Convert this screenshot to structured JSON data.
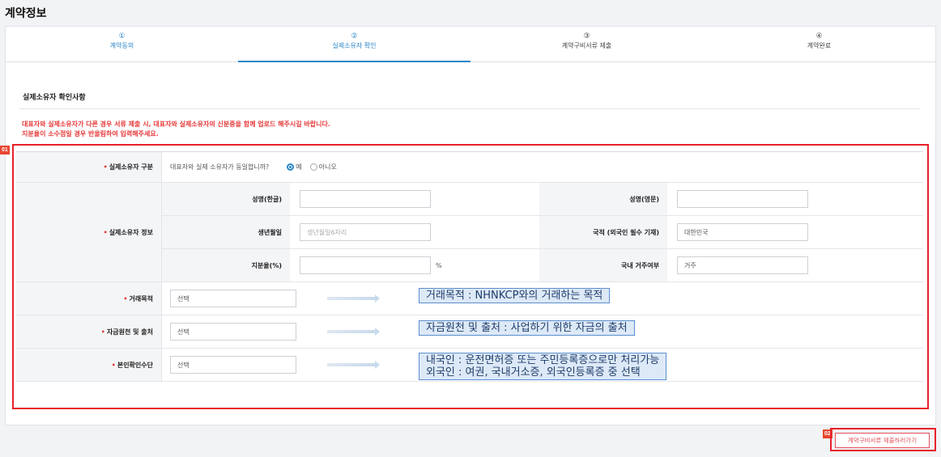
{
  "page_title": "계약정보",
  "steps": [
    {
      "num": "①",
      "label": "계약동의",
      "state": "done"
    },
    {
      "num": "②",
      "label": "실제소유자 확인",
      "state": "active"
    },
    {
      "num": "③",
      "label": "계약구비서류 제출",
      "state": "pending"
    },
    {
      "num": "④",
      "label": "계약완료",
      "state": "pending"
    }
  ],
  "section_title": "실제소유자 확인사항",
  "notice": {
    "line1": "대표자와 실제소유자가 다른 경우 서류 제출 시, 대표자와 실제소유자의 신분증을 함께 업로드 해주시길 바랍니다.",
    "line2": "지분율이 소수점일 경우 반올림하여 입력해주세요."
  },
  "markers": {
    "m1": "01",
    "m2": "02"
  },
  "owner_type": {
    "label": "실제소유자 구분",
    "question": "대표자와 실제 소유자가 동일합니까?",
    "options": [
      "예",
      "아니오"
    ],
    "selected": "예"
  },
  "owner_info": {
    "label": "실제소유자 정보",
    "name_kr_label": "성명(한글)",
    "name_kr_value": "",
    "name_en_label": "성명(영문)",
    "name_en_value": "",
    "birth_label": "생년월일",
    "birth_placeholder": "생년월일6자리",
    "nation_label": "국적 (외국인 필수 기재)",
    "nation_value": "대한민국",
    "share_label": "지분율(%)",
    "share_value": "",
    "share_unit": "%",
    "residence_label": "국내 거주여부",
    "residence_value": "거주"
  },
  "purpose": {
    "label": "거래목적",
    "value": "선택",
    "callout": "거래목적 : NHNKCP와의 거래하는 목적"
  },
  "fund": {
    "label": "자금원천 및 출처",
    "value": "선택",
    "callout": "자금원천 및 출처 : 사업하기 위한 자금의 출처"
  },
  "identity": {
    "label": "본인확인수단",
    "value": "선택",
    "callout_line1": "내국인 : 운전면허증 또는 주민등록증으로만 처리가능",
    "callout_line2": "외국인 : 여권, 국내거소증, 외국인등록증 중 선택"
  },
  "next_button": "계약구비서류 제출하러가기",
  "colors": {
    "accent": "#2a86c9",
    "warning": "#e63a3a",
    "highlight_box": "#e8202a"
  }
}
